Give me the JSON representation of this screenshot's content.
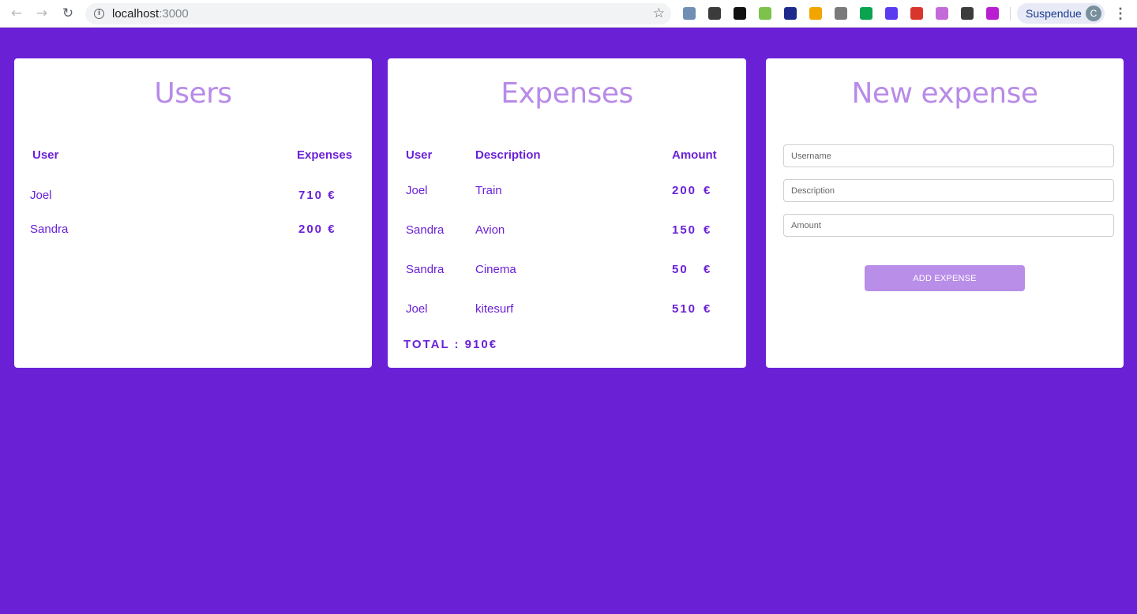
{
  "browser": {
    "url_host": "localhost",
    "url_port": ":3000",
    "profile_label": "Suspendue",
    "profile_initial": "C",
    "extensions": [
      {
        "name": "ext-1-icon",
        "color": "#6f8fb4"
      },
      {
        "name": "ext-2-icon",
        "color": "#3b3b3b"
      },
      {
        "name": "ext-3-icon",
        "color": "#111111"
      },
      {
        "name": "ext-4-icon",
        "color": "#7dc24b"
      },
      {
        "name": "ext-5-icon",
        "color": "#1d2a8c"
      },
      {
        "name": "ext-6-icon",
        "color": "#f2a500"
      },
      {
        "name": "ext-7-icon",
        "color": "#7a7a7a"
      },
      {
        "name": "ext-8-icon",
        "color": "#0aa34f"
      },
      {
        "name": "ext-9-icon",
        "color": "#5b3bf0"
      },
      {
        "name": "ext-10-icon",
        "color": "#d8362c"
      },
      {
        "name": "ext-11-icon",
        "color": "#c46ad8"
      },
      {
        "name": "ext-12-icon",
        "color": "#3c3c3c"
      },
      {
        "name": "ext-13-icon",
        "color": "#b81fd0"
      }
    ]
  },
  "colors": {
    "background": "#6a21d6",
    "accent": "#6a21d6",
    "title": "#b88be8",
    "button": "#b98ee9"
  },
  "users_card": {
    "title": "Users",
    "headers": {
      "user": "User",
      "expenses": "Expenses"
    },
    "rows": [
      {
        "user": "Joel",
        "expenses": "710 €"
      },
      {
        "user": "Sandra",
        "expenses": "200 €"
      }
    ]
  },
  "expenses_card": {
    "title": "Expenses",
    "headers": {
      "user": "User",
      "description": "Description",
      "amount": "Amount"
    },
    "rows": [
      {
        "user": "Joel",
        "description": "Train",
        "amount": "200",
        "currency": "€"
      },
      {
        "user": "Sandra",
        "description": "Avion",
        "amount": "150",
        "currency": "€"
      },
      {
        "user": "Sandra",
        "description": "Cinema",
        "amount": "50",
        "currency": "€"
      },
      {
        "user": "Joel",
        "description": "kitesurf",
        "amount": "510",
        "currency": "€"
      }
    ],
    "total": "TOTAL : 910€"
  },
  "new_expense_card": {
    "title": "New expense",
    "username_placeholder": "Username",
    "description_placeholder": "Description",
    "amount_placeholder": "Amount",
    "submit_label": "ADD EXPENSE"
  }
}
